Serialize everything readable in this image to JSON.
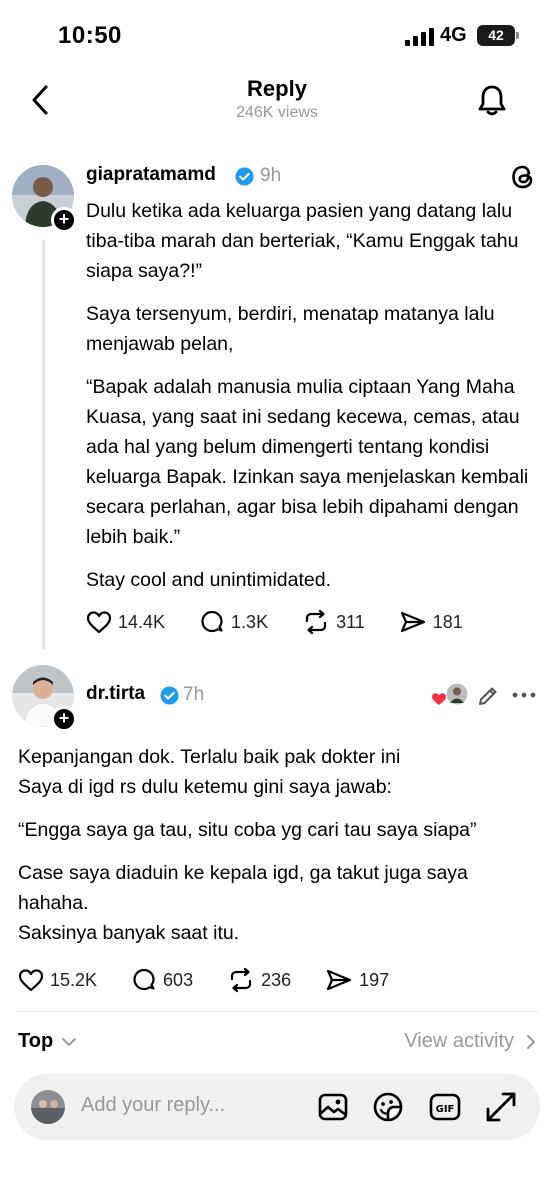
{
  "status": {
    "time": "10:50",
    "network": "4G",
    "battery": "42"
  },
  "header": {
    "title": "Reply",
    "views": "246K views"
  },
  "post": {
    "username": "giapratamamd",
    "time": "9h",
    "paragraphs": [
      "Dulu ketika ada keluarga pasien yang datang lalu tiba-tiba marah dan berteriak, “Kamu Enggak tahu siapa saya?!”",
      "Saya tersenyum, berdiri, menatap matanya lalu menjawab pelan,",
      "“Bapak adalah manusia mulia ciptaan Yang Maha Kuasa, yang saat ini sedang kecewa, cemas, atau ada hal yang belum dimengerti tentang kondisi keluarga Bapak. Izinkan saya menjelaskan kembali secara perlahan, agar bisa lebih dipahami dengan lebih baik.”",
      "Stay cool and unintimidated."
    ],
    "likes": "14.4K",
    "comments": "1.3K",
    "reposts": "311",
    "shares": "181"
  },
  "reply": {
    "username": "dr.tirta",
    "time": "7h",
    "line1": "Kepanjangan dok. Terlalu baik pak dokter ini",
    "line2": "Saya di igd rs dulu ketemu gini saya jawab:",
    "line3": "“Engga saya ga tau, situ coba yg cari tau saya siapa”",
    "line4": "Case saya diaduin ke kepala igd, ga takut juga saya hahaha.",
    "line5": "Saksinya banyak saat itu.",
    "likes": "15.2K",
    "comments": "603",
    "reposts": "236",
    "shares": "197"
  },
  "sort": {
    "label": "Top",
    "view_activity": "View activity"
  },
  "composer": {
    "placeholder": "Add your reply..."
  },
  "colors": {
    "verified": "#1d9bf0",
    "heart": "#ff3040",
    "muted": "#999999"
  }
}
